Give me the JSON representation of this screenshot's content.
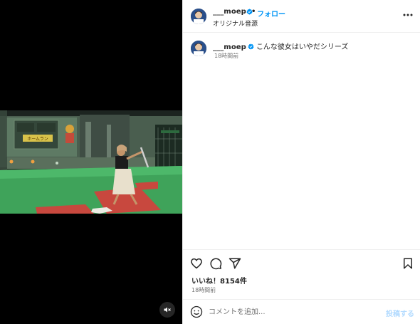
{
  "post": {
    "username": "___moep",
    "follow_label": "フォロー",
    "separator": "•",
    "audio_label": "オリジナル音源",
    "caption": "こんな彼女はいやだシリーズ",
    "caption_time": "18時間前",
    "likes_label": "いいね！8154件",
    "post_time": "18時間前"
  },
  "comment": {
    "placeholder": "コメントを追加...",
    "post_label": "投稿する"
  },
  "video": {
    "scoreboard_text": "ホームラン",
    "muted": true
  },
  "icons": {
    "verified": "verified-badge-icon",
    "more": "more-options-icon",
    "like": "heart-icon",
    "comment": "comment-icon",
    "share": "share-icon",
    "save": "bookmark-icon",
    "emoji": "emoji-icon",
    "mute": "muted-speaker-icon"
  },
  "colors": {
    "link_blue": "#0095f6",
    "post_button_disabled": "#b3dbff",
    "verified_blue": "#0095f6",
    "secondary_text": "#737373"
  }
}
